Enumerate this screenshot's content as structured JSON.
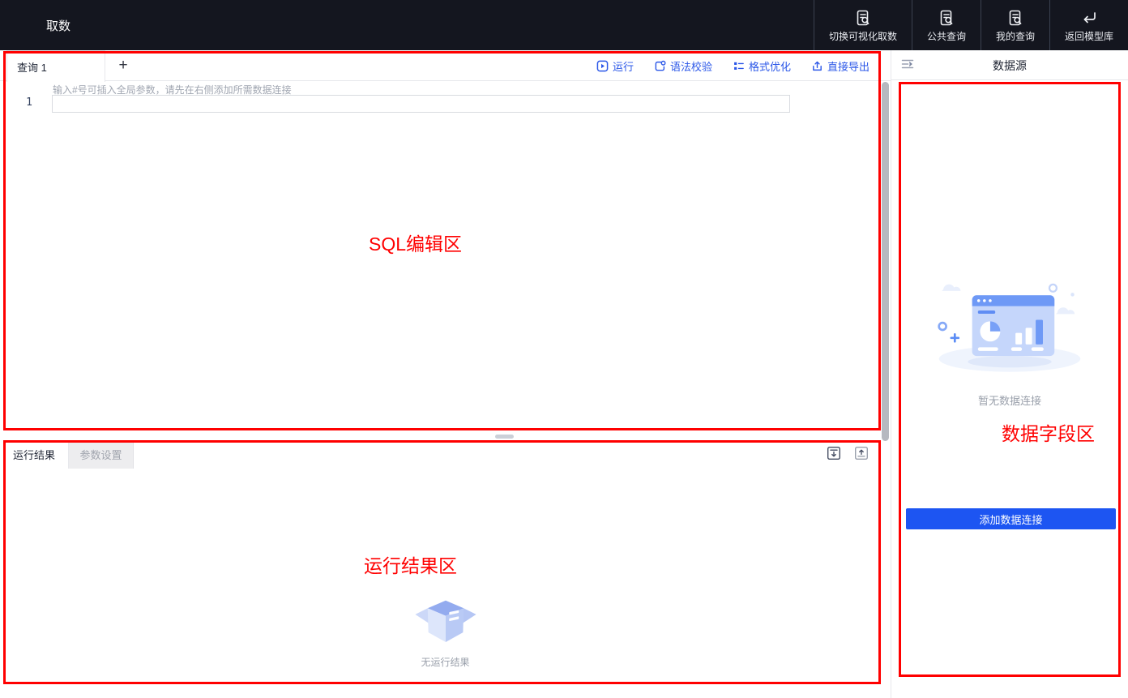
{
  "topbar": {
    "title": "取数",
    "actions": [
      {
        "label": "切换可视化取数",
        "icon": "doc-search-icon"
      },
      {
        "label": "公共查询",
        "icon": "doc-search-icon"
      },
      {
        "label": "我的查询",
        "icon": "doc-search-icon"
      },
      {
        "label": "返回模型库",
        "icon": "return-arrow-icon"
      }
    ]
  },
  "editor": {
    "tab_label": "查询 1",
    "add_tab_label": "+",
    "toolbar": [
      {
        "label": "运行",
        "icon": "run-icon"
      },
      {
        "label": "语法校验",
        "icon": "syntax-check-icon"
      },
      {
        "label": "格式优化",
        "icon": "format-icon"
      },
      {
        "label": "直接导出",
        "icon": "export-icon"
      }
    ],
    "line_number": "1",
    "placeholder": "输入#号可插入全局参数，请先在右侧添加所需数据连接"
  },
  "results": {
    "tabs": [
      {
        "label": "运行结果",
        "active": true
      },
      {
        "label": "参数设置",
        "active": false
      }
    ],
    "empty_text": "无运行结果"
  },
  "datasource": {
    "title": "数据源",
    "empty_text": "暂无数据连接",
    "add_button_label": "添加数据连接"
  },
  "annotations": {
    "labels": [
      {
        "text": "SQL编辑区"
      },
      {
        "text": "运行结果区"
      },
      {
        "text": "数据字段区"
      }
    ]
  },
  "colors": {
    "accent_blue": "#2b57e8",
    "button_blue": "#1d55f2",
    "annotation_red": "#ff0000",
    "topbar_bg": "#14161f"
  }
}
